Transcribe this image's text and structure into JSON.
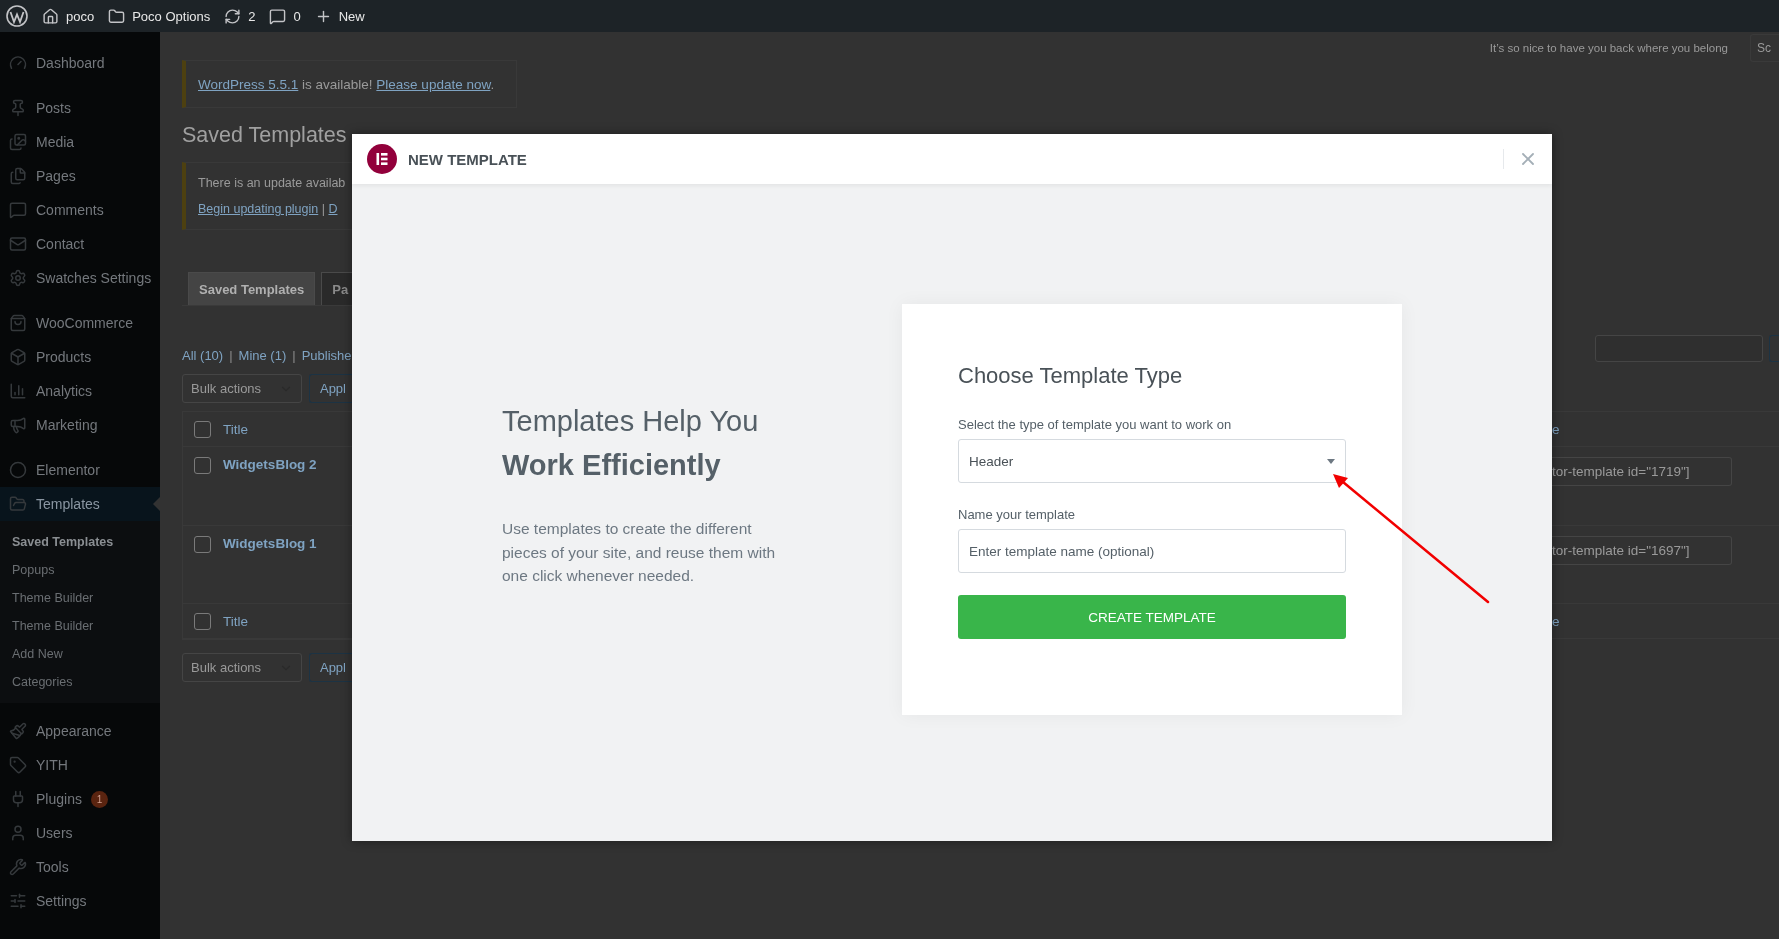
{
  "top_bar": {
    "items": [
      {
        "label": "poco"
      },
      {
        "label": "Poco Options"
      },
      {
        "label": "2"
      },
      {
        "label": "0"
      },
      {
        "label": "New"
      }
    ]
  },
  "sidebar": {
    "groups": [
      [
        {
          "label": "Dashboard",
          "selected": false
        }
      ],
      [
        {
          "label": "Posts",
          "selected": false
        },
        {
          "label": "Media",
          "selected": false
        },
        {
          "label": "Pages",
          "selected": false
        },
        {
          "label": "Comments",
          "selected": false
        },
        {
          "label": "Contact",
          "selected": false
        },
        {
          "label": "Swatches Settings",
          "selected": false
        }
      ],
      [
        {
          "label": "WooCommerce",
          "selected": false
        },
        {
          "label": "Products",
          "selected": false
        },
        {
          "label": "Analytics",
          "selected": false
        },
        {
          "label": "Marketing",
          "selected": false
        }
      ],
      [
        {
          "label": "Elementor",
          "selected": false
        },
        {
          "label": "Templates",
          "selected": true,
          "children": [
            {
              "label": "Saved Templates",
              "selected": true
            },
            {
              "label": "Popups",
              "selected": false
            },
            {
              "label": "Theme Builder",
              "selected": false
            },
            {
              "label": "Theme Builder",
              "selected": false
            },
            {
              "label": "Add New",
              "selected": false
            },
            {
              "label": "Categories",
              "selected": false
            }
          ]
        }
      ],
      [
        {
          "label": "Appearance",
          "selected": false
        },
        {
          "label": "YITH",
          "selected": false
        },
        {
          "label": "Plugins",
          "selected": false,
          "badge": "1"
        },
        {
          "label": "Users",
          "selected": false
        },
        {
          "label": "Tools",
          "selected": false
        },
        {
          "label": "Settings",
          "selected": false
        }
      ]
    ]
  },
  "update_notice": [
    {
      "text": "WordPress 5.5.1",
      "kind": "link"
    },
    {
      "text": " is available! ",
      "kind": "text"
    },
    {
      "text": "Please update now",
      "kind": "link"
    },
    {
      "text": ".",
      "kind": "text"
    }
  ],
  "greeting": "It’s so nice to have you back where you belong",
  "screen_options": "Sc",
  "heading": "Saved Templates",
  "plugin_notice": {
    "text": "There is an update availab",
    "actions": [
      {
        "text": "Begin updating plugin",
        "kind": "link"
      },
      {
        "text": " | ",
        "kind": "text"
      },
      {
        "text": "D",
        "kind": "link"
      }
    ]
  },
  "tabs": [
    {
      "label": "Saved Templates",
      "selected": true
    },
    {
      "label": "Pa",
      "selected": false
    }
  ],
  "views": {
    "separator": "|",
    "items": [
      "All (10)",
      "Mine (1)",
      "Publishe"
    ]
  },
  "bulk_top": {
    "select": "Bulk actions",
    "apply": "Appl"
  },
  "table": {
    "header_title": "Title",
    "header_column_2": "e",
    "header_checked": false,
    "footer_title": "Title",
    "footer_column_2": "e",
    "footer_checked": false,
    "rows": [
      {
        "title": "WidgetsBlog 2",
        "shortcode": "tor-template id=\"1719\"]",
        "checked": false
      },
      {
        "title": "WidgetsBlog 1",
        "shortcode": "tor-template id=\"1697\"]",
        "checked": false
      }
    ]
  },
  "bulk_bottom": {
    "select": "Bulk actions",
    "apply": "Appl"
  },
  "modal": {
    "title": "NEW TEMPLATE",
    "intro_title": "Templates Help You",
    "intro_title_bold": "Work Efficiently",
    "intro_text": "Use templates to create the different pieces of your site, and reuse them with one click whenever needed.",
    "form": {
      "title": "Choose Template Type",
      "type_label": "Select the type of template you want to work on",
      "type_value": "Header",
      "name_label": "Name your template",
      "name_placeholder": "Enter template name (optional)",
      "submit": "CREATE TEMPLATE"
    }
  }
}
